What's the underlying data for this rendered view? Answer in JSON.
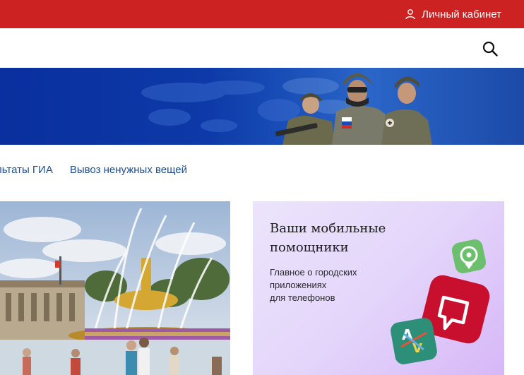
{
  "topbar": {
    "cabinet_label": "Личный кабинет",
    "bg_color": "#cc2222",
    "icon": "user-icon"
  },
  "header": {
    "search_icon": "search-icon"
  },
  "nav": {
    "items": [
      {
        "label": "льтаты ГИА"
      },
      {
        "label": "Вывоз ненужных вещей"
      }
    ],
    "link_color": "#1f4e96"
  },
  "promo": {
    "title": "Ваши мобильные помощники",
    "description": "Главное о городских\nприложениях\nдля телефонов",
    "icons": [
      "location-pin-app-icon",
      "chat-bubble-app-icon",
      "av-app-icon"
    ]
  }
}
